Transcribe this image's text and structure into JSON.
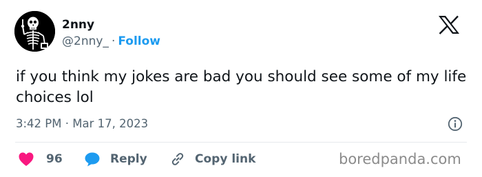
{
  "user": {
    "display_name": "2nny",
    "handle": "@2nny_",
    "separator": "·",
    "follow_label": "Follow"
  },
  "tweet": {
    "text": "if you think my jokes are bad you should see some of my life choices lol",
    "time": "3:42 PM",
    "date_separator": "·",
    "date": "Mar 17, 2023"
  },
  "actions": {
    "like_count": "96",
    "reply_label": "Reply",
    "copy_label": "Copy link"
  },
  "watermark": "boredpanda.com",
  "colors": {
    "accent": "#1d9bf0",
    "like": "#f91880",
    "text": "#0f1419",
    "muted": "#536471"
  },
  "icons": [
    "avatar-skeleton",
    "x-logo-icon",
    "info-icon",
    "heart-icon",
    "reply-bubble-icon",
    "link-icon"
  ]
}
